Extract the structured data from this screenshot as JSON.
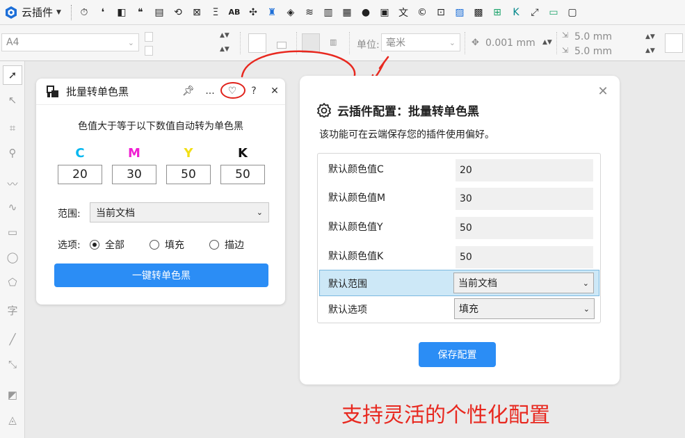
{
  "toolbar": {
    "plugin_label": "云插件",
    "icons": [
      "clock-icon",
      "quote-icon",
      "layers-icon",
      "double-quote-icon",
      "pdf-icon",
      "transform-icon",
      "crop-icon",
      "text-icon",
      "ab-icon",
      "puzzle-icon",
      "shape-icon",
      "link-icon",
      "lines-icon",
      "document-icon",
      "grid-icon",
      "001-icon",
      "image-icon",
      "translate-icon",
      "c-icon",
      "picture-icon",
      "photo-icon",
      "film-icon",
      "app-grid-icon",
      "k-icon",
      "expand-icon",
      "monitor-icon",
      "screen-icon"
    ]
  },
  "propbar": {
    "page_size": "A4",
    "unit_label": "单位:",
    "unit_value": "毫米",
    "nudge_value": "0.001 mm",
    "dup_x": "5.0 mm",
    "dup_y": "5.0 mm"
  },
  "panel1": {
    "title": "批量转单色黑",
    "more": "...",
    "help": "?",
    "close": "✕",
    "description": "色值大于等于以下数值自动转为单色黑",
    "cmyk": [
      {
        "letter": "C",
        "value": "20",
        "color": "#00b7f0"
      },
      {
        "letter": "M",
        "value": "30",
        "color": "#f01fd2"
      },
      {
        "letter": "Y",
        "value": "50",
        "color": "#f2df16"
      },
      {
        "letter": "K",
        "value": "50",
        "color": "#111111"
      }
    ],
    "scope_label": "范围:",
    "scope_value": "当前文档",
    "options_label": "选项:",
    "options": [
      {
        "label": "全部",
        "selected": true
      },
      {
        "label": "填充",
        "selected": false
      },
      {
        "label": "描边",
        "selected": false
      }
    ],
    "button_label": "一键转单色黑"
  },
  "panel2": {
    "title": "云插件配置：批量转单色黑",
    "description": "该功能可在云端保存您的插件使用偏好。",
    "rows": [
      {
        "label": "默认颜色值C",
        "value": "20"
      },
      {
        "label": "默认颜色值M",
        "value": "30"
      },
      {
        "label": "默认颜色值Y",
        "value": "50"
      },
      {
        "label": "默认颜色值K",
        "value": "50"
      }
    ],
    "scope_label": "默认范围",
    "scope_value": "当前文档",
    "option_label": "默认选项",
    "option_value": "填充",
    "save_label": "保存配置"
  },
  "caption": "支持灵活的个性化配置"
}
